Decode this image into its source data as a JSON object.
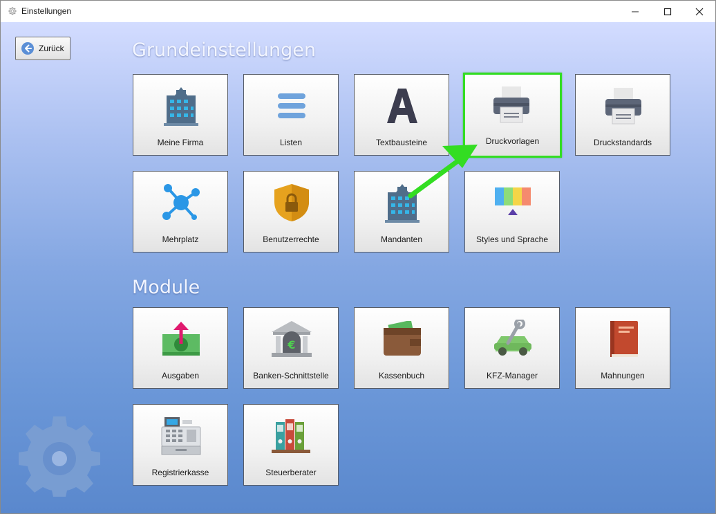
{
  "window": {
    "title": "Einstellungen",
    "icon": "gear-icon",
    "controls": [
      "minimize-icon",
      "maximize-icon",
      "close-icon"
    ]
  },
  "back_button": {
    "label": "Zurück",
    "icon": "arrow-left-circle-icon"
  },
  "sections": {
    "grundeinstellungen": {
      "title": "Grundeinstellungen",
      "tiles": [
        {
          "label": "Meine Firma",
          "icon": "office-building-icon"
        },
        {
          "label": "Listen",
          "icon": "list-icon"
        },
        {
          "label": "Textbausteine",
          "icon": "letter-a-icon"
        },
        {
          "label": "Druckvorlagen",
          "icon": "printer-icon",
          "selected": true
        },
        {
          "label": "Druckstandards",
          "icon": "printer-icon"
        },
        {
          "label": "Mehrplatz",
          "icon": "network-hub-icon"
        },
        {
          "label": "Benutzerrechte",
          "icon": "shield-lock-icon"
        },
        {
          "label": "Mandanten",
          "icon": "office-building-icon"
        },
        {
          "label": "Styles und Sprache",
          "icon": "color-palette-icon"
        }
      ]
    },
    "module": {
      "title": "Module",
      "tiles": [
        {
          "label": "Ausgaben",
          "icon": "money-out-icon"
        },
        {
          "label": "Banken-Schnittstelle",
          "icon": "bank-euro-icon"
        },
        {
          "label": "Kassenbuch",
          "icon": "wallet-icon"
        },
        {
          "label": "KFZ-Manager",
          "icon": "car-wrench-icon"
        },
        {
          "label": "Mahnungen",
          "icon": "book-icon"
        },
        {
          "label": "Registrierkasse",
          "icon": "cash-register-icon"
        },
        {
          "label": "Steuerberater",
          "icon": "binders-icon"
        }
      ]
    }
  },
  "annotation": {
    "icon": "green-arrow-icon",
    "target": "Druckvorlagen",
    "color": "#33dd22"
  },
  "decoration": {
    "icon": "large-gear-icon"
  }
}
